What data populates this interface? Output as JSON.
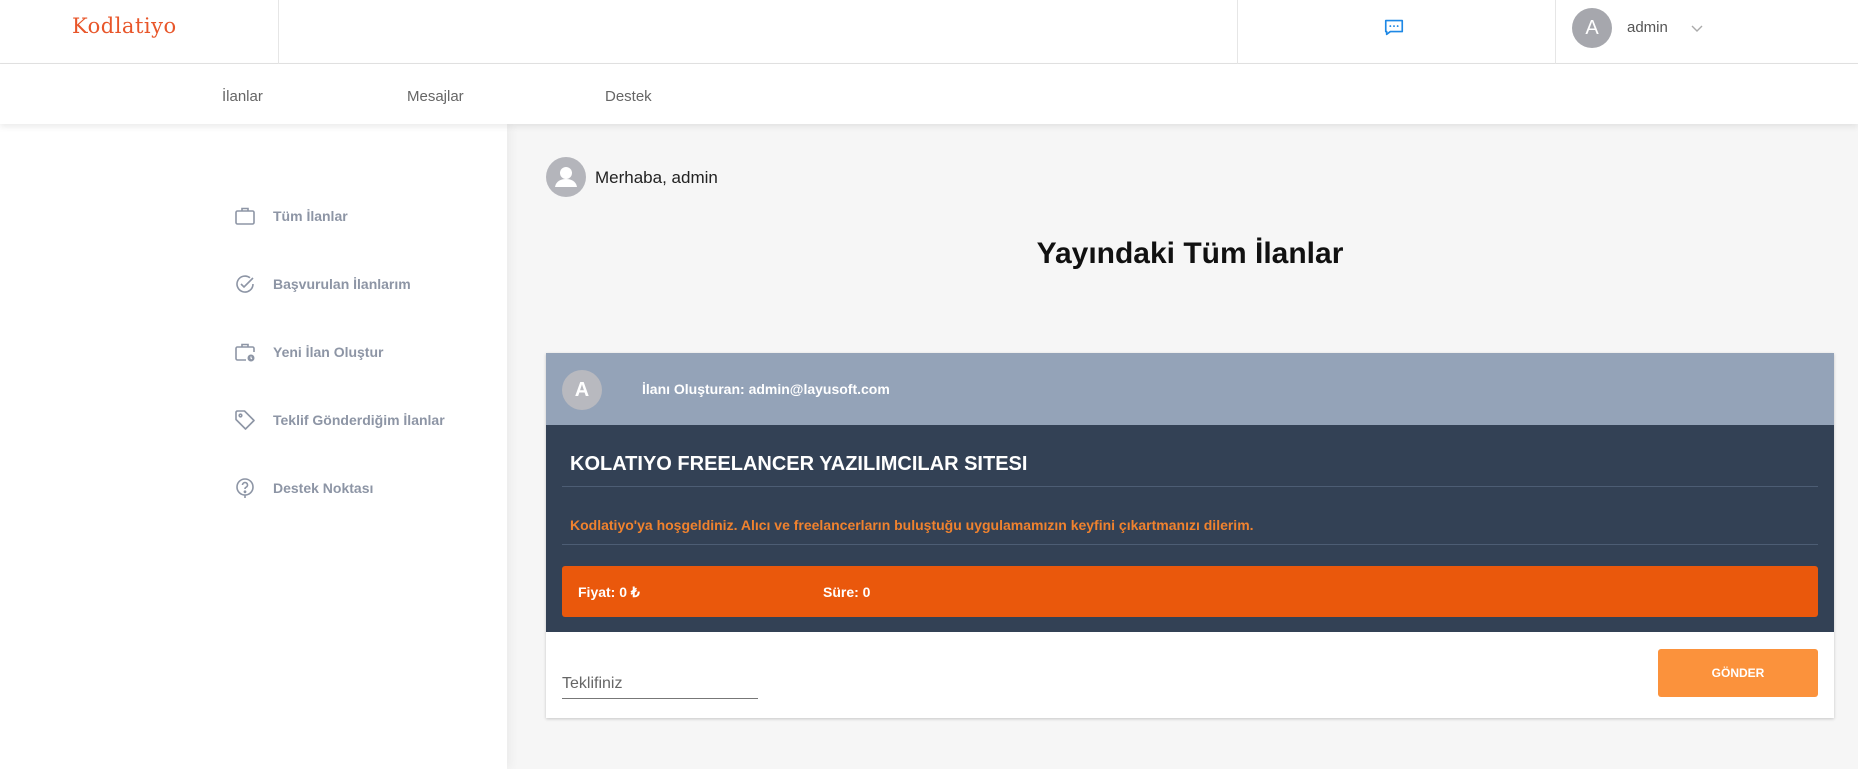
{
  "header": {
    "logo": "Kodlatiyo",
    "user": {
      "avatar_letter": "A",
      "name": "admin"
    }
  },
  "nav": {
    "items": [
      "İlanlar",
      "Mesajlar",
      "Destek"
    ]
  },
  "sidebar": {
    "items": [
      {
        "label": "Tüm İlanlar",
        "icon": "briefcase-icon"
      },
      {
        "label": "Başvurulan İlanlarım",
        "icon": "check-circle-icon"
      },
      {
        "label": "Yeni İlan Oluştur",
        "icon": "briefcase-clock-icon"
      },
      {
        "label": "Teklif Gönderdiğim İlanlar",
        "icon": "tag-icon"
      },
      {
        "label": "Destek Noktası",
        "icon": "question-circle-icon"
      }
    ]
  },
  "main": {
    "greeting": "Merhaba, admin",
    "title": "Yayındaki Tüm İlanlar"
  },
  "listing": {
    "avatar_letter": "A",
    "creator": "İlanı Oluşturan: admin@layusoft.com",
    "title": "KOLATIYO FREELANCER YAZILIMCILAR SITESI",
    "description": "Kodlatiyo'ya hoşgeldiniz. Alıcı ve freelancerların buluştuğu uygulamamızın keyfini çıkartmanızı dilerim.",
    "price": "Fiyat: 0 ₺",
    "duration": "Süre: 0",
    "offer_placeholder": "Teklifiniz",
    "send_label": "GÖNDER"
  },
  "colors": {
    "brand": "#e8562a",
    "card_header": "#94a3b8",
    "card_body": "#334155",
    "price_bar": "#ea580c",
    "send_button": "#fb923c",
    "message_icon": "#1e88e5"
  }
}
